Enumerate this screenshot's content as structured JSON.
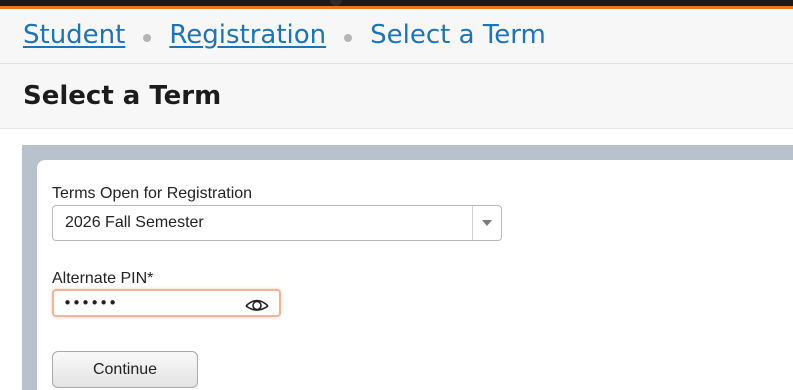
{
  "breadcrumb": {
    "items": [
      {
        "label": "Student"
      },
      {
        "label": "Registration"
      },
      {
        "label": "Select a Term"
      }
    ]
  },
  "page": {
    "title": "Select a Term"
  },
  "form": {
    "term": {
      "label": "Terms Open for Registration",
      "selected": "2026 Fall Semester"
    },
    "pin": {
      "label": "Alternate PIN*",
      "masked_value": "••••••"
    },
    "continue_label": "Continue"
  },
  "colors": {
    "accent_orange": "#e87722",
    "link_blue": "#1f74b5",
    "frame_gray_blue": "#b7c2cd"
  },
  "icons": {
    "pin_visibility": "eye-icon",
    "select": "chevron-down-icon"
  }
}
